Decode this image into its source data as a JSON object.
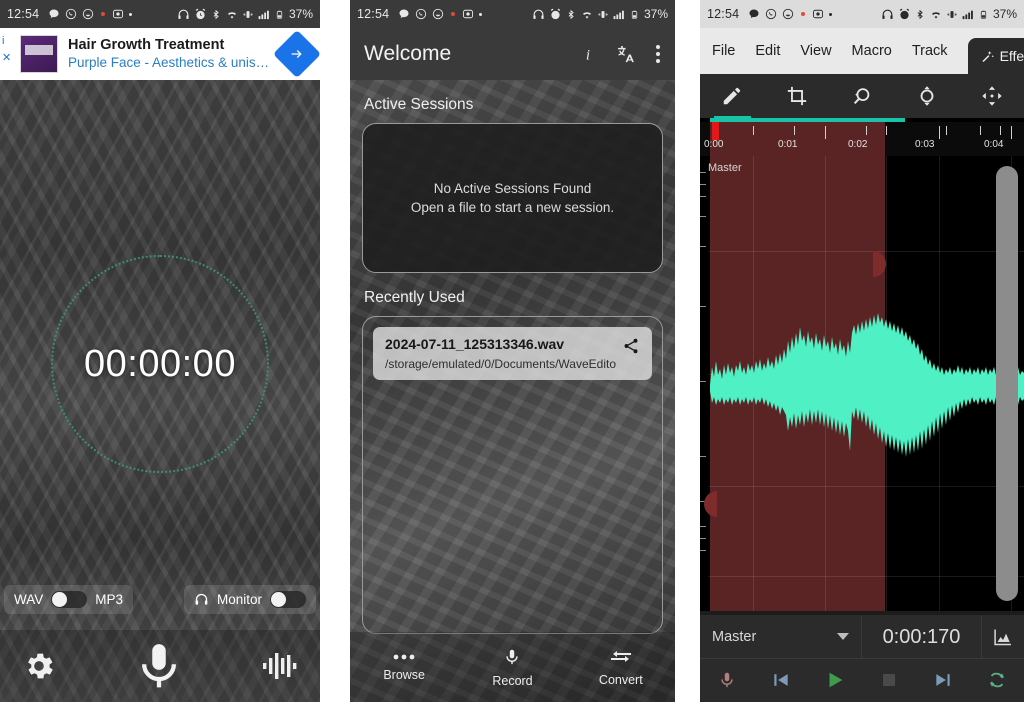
{
  "status_bar": {
    "time": "12:54",
    "battery": "37%",
    "left_icons": [
      "chat-icon",
      "whatsapp-icon",
      "emoji-icon",
      "dot-red-icon",
      "camera-icon",
      "dot-icon"
    ],
    "right_icons": [
      "headphones-icon",
      "alarm-icon",
      "bluetooth-icon",
      "wifi-icon",
      "vibrate-icon",
      "signal-icon",
      "battery-icon"
    ]
  },
  "recorder": {
    "ad": {
      "title": "Hair Growth Treatment",
      "subtitle": "Purple Face - Aesthetics & unisex...",
      "info_badge": "i",
      "close_badge": "✕",
      "cta_icon": "arrow-right-icon"
    },
    "timer": "00:00:00",
    "format_left": "WAV",
    "format_right": "MP3",
    "format_toggle_state": "WAV",
    "monitor_label": "Monitor",
    "monitor_toggle_state": "off",
    "bottom": {
      "settings": "gear-icon",
      "record": "microphone-icon",
      "levels": "waveform-icon"
    }
  },
  "welcome": {
    "title": "Welcome",
    "actions": [
      "info-icon",
      "translate-icon",
      "overflow-menu-icon"
    ],
    "active_sessions": {
      "heading": "Active Sessions",
      "empty_line1": "No Active Sessions Found",
      "empty_line2": "Open a file to start a new session."
    },
    "recently_used": {
      "heading": "Recently Used",
      "file_name": "2024-07-11_125313346.wav",
      "file_path": "/storage/emulated/0/Documents/WaveEdito",
      "share_icon": "share-icon"
    },
    "nav": [
      {
        "label": "Browse",
        "icon": "ellipsis-icon"
      },
      {
        "label": "Record",
        "icon": "microphone-icon"
      },
      {
        "label": "Convert",
        "icon": "convert-arrows-icon"
      }
    ]
  },
  "editor": {
    "menu": [
      "File",
      "Edit",
      "View",
      "Macro",
      "Track"
    ],
    "effects_tab": "Effects",
    "effects_icon": "magic-wand-icon",
    "tools": [
      {
        "name": "pencil-tool",
        "active": true
      },
      {
        "name": "crop-tool",
        "active": false
      },
      {
        "name": "zoom-out-tool",
        "active": false
      },
      {
        "name": "zoom-in-tool",
        "active": false
      },
      {
        "name": "move-tool",
        "active": false
      }
    ],
    "ruler_labels": [
      "0:00",
      "0:01",
      "0:02",
      "0:03",
      "0:04"
    ],
    "track_label": "Master",
    "transport": {
      "track_select": "Master",
      "time": "0:00:170",
      "graph_icon": "chart-icon",
      "buttons": [
        "record-icon",
        "skip-previous-icon",
        "play-icon",
        "stop-icon",
        "skip-next-icon",
        "loop-icon"
      ]
    },
    "colors": {
      "waveform": "#4ff0c4",
      "selection": "#5b2424",
      "accent": "#18c3a8",
      "playhead": "#e11919",
      "play_button": "#3f9a4e"
    }
  }
}
